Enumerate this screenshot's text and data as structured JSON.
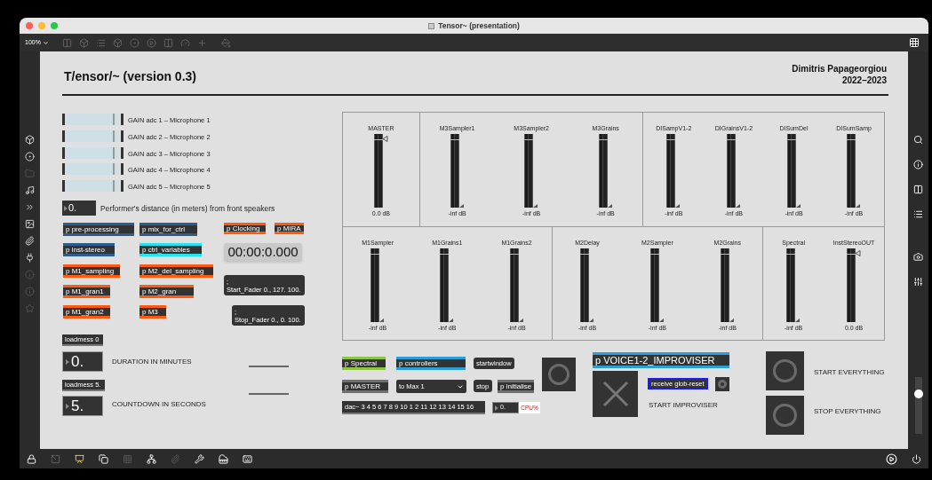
{
  "window": {
    "title": "Tensor~ (presentation)"
  },
  "toolbar": {
    "zoom": "100%"
  },
  "volume": {
    "level": 0.75
  },
  "patch": {
    "title": "T/ensor/~ (version 0.3)",
    "author": "Dimitris Papageorgiou",
    "years": "2022–2023",
    "gain_sliders": [
      {
        "label": "GAIN adc 1 – Microphone 1",
        "level": 0.88
      },
      {
        "label": "GAIN adc 2 – Microphone 2",
        "level": 0.88
      },
      {
        "label": "GAIN adc 3 – Microphone 3",
        "level": 0.88
      },
      {
        "label": "GAIN adc 4 – Microphone 4",
        "level": 0.88
      },
      {
        "label": "GAIN adc 5 – Microphone 5",
        "level": 0.88
      }
    ],
    "distance": {
      "value": "0.",
      "label": "Performer's distance (in meters) from front speakers"
    },
    "objects": [
      {
        "kind": "subpatch",
        "text": "p pre-processing",
        "color": "#2c5d8f"
      },
      {
        "kind": "subpatch",
        "text": "p mix_for_ctrl",
        "color": "#2c5d8f"
      },
      {
        "kind": "subpatch",
        "text": "p Clocking",
        "color": "#ff5a10"
      },
      {
        "kind": "subpatch",
        "text": "p MIRA",
        "color": "#ff5a10"
      },
      {
        "kind": "subpatch",
        "text": "p inst-stereo",
        "color": "#2c5d8f"
      },
      {
        "kind": "subpatch",
        "text": "p ctrl_variables",
        "color": "#22e5f0"
      },
      {
        "kind": "clock",
        "text": "00:00:0.000"
      },
      {
        "kind": "subpatch",
        "text": "p M1_sampling",
        "color": "#ff5a10"
      },
      {
        "kind": "subpatch",
        "text": "p M2_del_sampling",
        "color": "#ff5a10"
      },
      {
        "kind": "subpatch",
        "text": "p M1_gran1",
        "color": "#ff5a10"
      },
      {
        "kind": "subpatch",
        "text": "p M2_gran",
        "color": "#ff5a10"
      },
      {
        "kind": "message",
        "lines": [
          ";",
          "Start_Fader 0., 127. 100."
        ]
      },
      {
        "kind": "subpatch",
        "text": "p M1_gran2",
        "color": "#ff5a10"
      },
      {
        "kind": "subpatch",
        "text": "p M3",
        "color": "#ff5a10"
      },
      {
        "kind": "message",
        "lines": [
          ";",
          "Stop_Fader 0., 0. 100."
        ]
      },
      {
        "kind": "object",
        "text": "loadmess 0"
      },
      {
        "kind": "number",
        "text": "0."
      },
      {
        "kind": "comment",
        "text": "DURATION IN MINUTES"
      },
      {
        "kind": "object",
        "text": "loadmess 5."
      },
      {
        "kind": "number",
        "text": "5."
      },
      {
        "kind": "comment",
        "text": "COUNTDOWN IN SECONDS"
      },
      {
        "kind": "subpatch",
        "text": "p Spectral",
        "color": "#8cc63f"
      },
      {
        "kind": "subpatch",
        "text": "p controllers",
        "color": "#2a9fd6"
      },
      {
        "kind": "message",
        "lines": [
          "startwindow"
        ]
      },
      {
        "kind": "subpatch",
        "text": "p MASTER",
        "color": "#707070"
      },
      {
        "kind": "dropdown",
        "text": "to Max 1"
      },
      {
        "kind": "message",
        "lines": [
          "stop"
        ]
      },
      {
        "kind": "subpatch",
        "text": "p initialise",
        "color": "#707070"
      },
      {
        "kind": "object",
        "text": "dac~ 3 4 5 6 7 8 9 10 1 2 11 12 13 14 15 16"
      },
      {
        "kind": "smallnumber",
        "text": "0."
      },
      {
        "kind": "cpu",
        "text": "CPU%"
      },
      {
        "kind": "button"
      },
      {
        "kind": "subpatch",
        "text": "p VOICE1-2_IMPROVISER",
        "color": "#2a9fd6"
      },
      {
        "kind": "toggle",
        "checked": true
      },
      {
        "kind": "receive",
        "text": "receive glob-reset",
        "color": "#1a1aff"
      },
      {
        "kind": "button"
      },
      {
        "kind": "comment",
        "text": "START IMPROVISER"
      },
      {
        "kind": "button"
      },
      {
        "kind": "comment",
        "text": "START  EVERYTHING"
      },
      {
        "kind": "button"
      },
      {
        "kind": "comment",
        "text": "STOP EVERYTHING"
      }
    ],
    "meter_rows": [
      {
        "sections": [
          {
            "meters": [
              {
                "name": "MASTER",
                "kind": "gain",
                "reading": "0.0 dB"
              }
            ]
          },
          {
            "meters": [
              {
                "name": "M3Sampler1",
                "kind": "meter",
                "reading": "-inf dB"
              },
              {
                "name": "M3Sampler2",
                "kind": "meter",
                "reading": "-inf dB"
              },
              {
                "name": "M3Grains",
                "kind": "meter",
                "reading": "-inf dB"
              }
            ]
          },
          {
            "meters": [
              {
                "name": "DISampV1-2",
                "kind": "meter",
                "reading": "-inf dB"
              },
              {
                "name": "DIGrainsV1-2",
                "kind": "meter",
                "reading": "-inf dB"
              },
              {
                "name": "DISumDel",
                "kind": "meter",
                "reading": "-inf dB"
              },
              {
                "name": "DISumSamp",
                "kind": "meter",
                "reading": "-inf dB"
              }
            ]
          }
        ]
      },
      {
        "sections": [
          {
            "meters": [
              {
                "name": "M1Sampler",
                "kind": "meter",
                "reading": "-inf dB"
              },
              {
                "name": "M1Grains1",
                "kind": "meter",
                "reading": "-inf dB"
              },
              {
                "name": "M1Grains2",
                "kind": "meter",
                "reading": "-inf dB"
              }
            ]
          },
          {
            "meters": [
              {
                "name": "M2Delay",
                "kind": "meter",
                "reading": "-inf dB"
              },
              {
                "name": "M2Sampler",
                "kind": "meter",
                "reading": "-inf dB"
              },
              {
                "name": "M2Grains",
                "kind": "meter",
                "reading": "-inf dB"
              }
            ]
          },
          {
            "meters": [
              {
                "name": "Spectral",
                "kind": "meter",
                "reading": "-inf dB"
              },
              {
                "name": "InstStereoOUT",
                "kind": "gain",
                "reading": "0.0 dB"
              }
            ]
          }
        ]
      }
    ]
  }
}
